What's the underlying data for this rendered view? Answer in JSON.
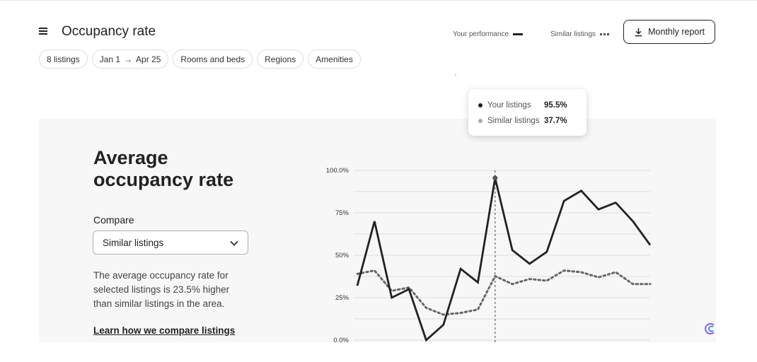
{
  "header": {
    "title": "Occupancy rate",
    "report_button": "Monthly report"
  },
  "filters": [
    {
      "label": "8 listings"
    },
    {
      "label_from": "Jan 1",
      "label_to": "Apr 25"
    },
    {
      "label": "Rooms and beds"
    },
    {
      "label": "Regions"
    },
    {
      "label": "Amenities"
    }
  ],
  "panel": {
    "title": "Average occupancy rate",
    "compare_label": "Compare",
    "compare_value": "Similar listings",
    "description": "The average occupancy rate for selected listings is 23.5% higher than similar listings in the area.",
    "learn_link": "Learn how we compare listings"
  },
  "legend": {
    "performance": "Your performance",
    "similar": "Similar listings"
  },
  "tooltip": {
    "your_label": "Your listings",
    "your_value": "95.5%",
    "similar_label": "Similar listings",
    "similar_value": "37.7%"
  },
  "colors": {
    "primary_line": "#222222",
    "similar_line": "#666666",
    "panel_bg": "#f7f7f7",
    "grid": "#dddddd"
  },
  "chart_data": {
    "type": "line",
    "y_ticks": [
      "100.0%",
      "75%",
      "50%",
      "25%",
      "0.0%"
    ],
    "ylim": [
      0,
      100
    ],
    "highlight_index": 8,
    "series": [
      {
        "name": "Your performance",
        "style": "solid",
        "values": [
          32,
          70,
          25,
          30,
          0,
          9,
          42,
          34,
          95.5,
          53,
          45,
          52,
          82,
          88,
          77,
          81,
          70,
          56
        ]
      },
      {
        "name": "Similar listings",
        "style": "dotted",
        "values": [
          39,
          41,
          29,
          31,
          19,
          15,
          16,
          18,
          37.7,
          33,
          36,
          35,
          41,
          40,
          37,
          40,
          33,
          33
        ]
      }
    ]
  }
}
